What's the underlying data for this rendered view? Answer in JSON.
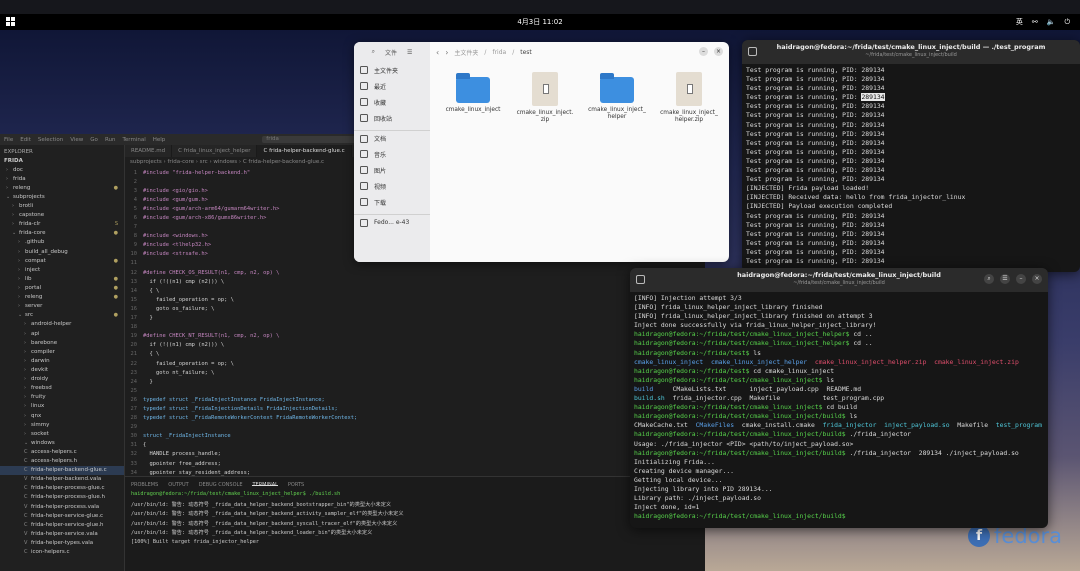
{
  "topbar": {
    "clock": "4月3日 11:02",
    "ime": "英"
  },
  "brand": {
    "name": "fedora"
  },
  "vscode": {
    "menu": [
      "File",
      "Edit",
      "Selection",
      "View",
      "Go",
      "Run",
      "Terminal",
      "Help"
    ],
    "search": "frida",
    "explorer": {
      "header": "EXPLORER",
      "root": "FRIDA",
      "items": [
        {
          "label": "doc",
          "arrow": "›",
          "indent": 1
        },
        {
          "label": "frida",
          "arrow": "›",
          "indent": 1
        },
        {
          "label": "releng",
          "arrow": "›",
          "indent": 1,
          "status": "●"
        },
        {
          "label": "subprojects",
          "arrow": "⌄",
          "indent": 1
        },
        {
          "label": "brotli",
          "arrow": "›",
          "indent": 2
        },
        {
          "label": "capstone",
          "arrow": "›",
          "indent": 2
        },
        {
          "label": "frida-clr",
          "arrow": "›",
          "indent": 2,
          "status": "S"
        },
        {
          "label": "frida-core",
          "arrow": "⌄",
          "indent": 2,
          "status": "●"
        },
        {
          "label": ".github",
          "arrow": "›",
          "indent": 3
        },
        {
          "label": "build_all_debug",
          "arrow": "›",
          "indent": 3
        },
        {
          "label": "compat",
          "arrow": "›",
          "indent": 3,
          "status": "●"
        },
        {
          "label": "inject",
          "arrow": "›",
          "indent": 3
        },
        {
          "label": "lib",
          "arrow": "›",
          "indent": 3,
          "status": "●"
        },
        {
          "label": "portal",
          "arrow": "›",
          "indent": 3,
          "status": "●"
        },
        {
          "label": "releng",
          "arrow": "›",
          "indent": 3,
          "status": "●"
        },
        {
          "label": "server",
          "arrow": "›",
          "indent": 3
        },
        {
          "label": "src",
          "arrow": "⌄",
          "indent": 3,
          "status": "●"
        },
        {
          "label": "android-helper",
          "arrow": "›",
          "indent": 4
        },
        {
          "label": "api",
          "arrow": "›",
          "indent": 4
        },
        {
          "label": "barebone",
          "arrow": "›",
          "indent": 4
        },
        {
          "label": "compiler",
          "arrow": "›",
          "indent": 4
        },
        {
          "label": "darwin",
          "arrow": "›",
          "indent": 4
        },
        {
          "label": "devkit",
          "arrow": "›",
          "indent": 4
        },
        {
          "label": "droidy",
          "arrow": "›",
          "indent": 4
        },
        {
          "label": "freebsd",
          "arrow": "›",
          "indent": 4
        },
        {
          "label": "fruity",
          "arrow": "›",
          "indent": 4
        },
        {
          "label": "linux",
          "arrow": "›",
          "indent": 4
        },
        {
          "label": "qnx",
          "arrow": "›",
          "indent": 4
        },
        {
          "label": "simmy",
          "arrow": "›",
          "indent": 4
        },
        {
          "label": "socket",
          "arrow": "›",
          "indent": 4
        },
        {
          "label": "windows",
          "arrow": "⌄",
          "indent": 4
        },
        {
          "label": "access-helpers.c",
          "arrow": "C",
          "indent": 4
        },
        {
          "label": "access-helpers.h",
          "arrow": "C",
          "indent": 4
        },
        {
          "label": "frida-helper-backend-glue.c",
          "arrow": "C",
          "indent": 4,
          "active": true
        },
        {
          "label": "frida-helper-backend.vala",
          "arrow": "V",
          "indent": 4
        },
        {
          "label": "frida-helper-process-glue.c",
          "arrow": "C",
          "indent": 4
        },
        {
          "label": "frida-helper-process-glue.h",
          "arrow": "C",
          "indent": 4
        },
        {
          "label": "frida-helper-process.vala",
          "arrow": "V",
          "indent": 4
        },
        {
          "label": "frida-helper-service-glue.c",
          "arrow": "C",
          "indent": 4
        },
        {
          "label": "frida-helper-service-glue.h",
          "arrow": "C",
          "indent": 4
        },
        {
          "label": "frida-helper-service.vala",
          "arrow": "V",
          "indent": 4
        },
        {
          "label": "frida-helper-types.vala",
          "arrow": "V",
          "indent": 4
        },
        {
          "label": "icon-helpers.c",
          "arrow": "C",
          "indent": 4
        }
      ]
    },
    "tabs": [
      "README.md",
      "C frida_linux_inject_helper",
      "C frida-helper-backend-glue.c"
    ],
    "breadcrumb": "subprojects › frida-core › src › windows › C frida-helper-backend-glue.c",
    "code": [
      "#include \"frida-helper-backend.h\"",
      "",
      "#include <gio/gio.h>",
      "#include <gum/gum.h>",
      "#include <gum/arch-arm64/gumarm64writer.h>",
      "#include <gum/arch-x86/gumx86writer.h>",
      "",
      "#include <windows.h>",
      "#include <tlhelp32.h>",
      "#include <strsafe.h>",
      "",
      "#define CHECK_OS_RESULT(n1, cmp, n2, op) \\",
      "  if (!((n1) cmp (n2))) \\",
      "  { \\",
      "    failed_operation = op; \\",
      "    goto os_failure; \\",
      "  }",
      "",
      "#define CHECK_NT_RESULT(n1, cmp, n2, op) \\",
      "  if (!((n1) cmp (n2))) \\",
      "  { \\",
      "    failed_operation = op; \\",
      "    goto nt_failure; \\",
      "  }",
      "",
      "typedef struct _FridaInjectInstance FridaInjectInstance;",
      "typedef struct _FridaInjectionDetails FridaInjectionDetails;",
      "typedef struct _FridaRemoteWorkerContext FridaRemoteWorkerContext;",
      "",
      "struct _FridaInjectInstance",
      "{",
      "  HANDLE process_handle;",
      "  gpointer free_address;",
      "  gpointer stay_resident_address;",
      "};",
      "",
      "struct _FridaInjectionDetails",
      "{"
    ],
    "panel_tabs": [
      "PROBLEMS",
      "OUTPUT",
      "DEBUG CONSOLE",
      "TERMINAL",
      "PORTS"
    ],
    "terminal": [
      "haidragon@fedora:~/frida/test/cmake_linux_inject_helper$ ./build.sh",
      "/usr/bin/ld: 警告: 动态符号 _frida_data_helper_backend_bootstrapper_bin\"的类型大小未定义",
      "/usr/bin/ld: 警告: 动态符号 _frida_data_helper_backend_activity_sampler_elf\"的类型大小未定义",
      "/usr/bin/ld: 警告: 动态符号 _frida_data_helper_backend_syscall_tracer_elf\"的类型大小未定义",
      "/usr/bin/ld: 警告: 动态符号 _frida_data_helper_backend_loader_bin\"的类型大小未定义",
      "[100%] Built target frida_injector_helper"
    ]
  },
  "files": {
    "title": "文件",
    "sidebar": [
      {
        "label": "主文件夹",
        "icon": "home-icon"
      },
      {
        "label": "最近",
        "icon": "clock-icon"
      },
      {
        "label": "收藏",
        "icon": "star-icon"
      },
      {
        "label": "回收站",
        "icon": "trash-icon"
      },
      {
        "label": "文档",
        "icon": "document-icon",
        "sep": true
      },
      {
        "label": "音乐",
        "icon": "music-icon"
      },
      {
        "label": "图片",
        "icon": "image-icon"
      },
      {
        "label": "视频",
        "icon": "video-icon"
      },
      {
        "label": "下载",
        "icon": "download-icon"
      },
      {
        "label": "Fedo... e-43",
        "icon": "drive-icon",
        "sep": true
      }
    ],
    "path": [
      "主文件夹",
      "frida",
      "test"
    ],
    "items": [
      {
        "name": "cmake_linux_inject",
        "kind": "folder"
      },
      {
        "name": "cmake_linux_inject.zip",
        "kind": "zip"
      },
      {
        "name": "cmake_linux_inject_helper",
        "kind": "folder"
      },
      {
        "name": "cmake_linux_inject_helper.zip",
        "kind": "zip"
      }
    ]
  },
  "term1": {
    "title": "haidragon@fedora:~/frida/test/cmake_linux_inject/build — ./test_program",
    "subtitle": "~/frida/test/cmake_linux_inject/build",
    "lines": [
      "Test program is running, PID: 289134",
      "Test program is running, PID: 289134",
      "Test program is running, PID: 289134",
      "Test program is running, PID: 289134",
      "Test program is running, PID: 289134",
      "Test program is running, PID: 289134",
      "Test program is running, PID: 289134",
      "Test program is running, PID: 289134",
      "Test program is running, PID: 289134",
      "Test program is running, PID: 289134",
      "Test program is running, PID: 289134",
      "Test program is running, PID: 289134",
      "Test program is running, PID: 289134",
      "[INJECTED] Frida payload loaded!",
      "[INJECTED] Received data: hello from frida_injector_linux",
      "[INJECTED] Payload execution completed",
      "Test program is running, PID: 289134",
      "Test program is running, PID: 289134",
      "Test program is running, PID: 289134",
      "Test program is running, PID: 289134",
      "Test program is running, PID: 289134",
      "Test program is running, PID: 289134"
    ],
    "highlighted": "289134"
  },
  "term2": {
    "title": "haidragon@fedora:~/frida/test/cmake_linux_inject/build",
    "subtitle": "~/frida/test/cmake_linux_inject/build",
    "lines": [
      "[INFO] Injection attempt 3/3",
      "[INFO] frida_linux_helper_inject_library finished",
      "[INFO] frida_linux_helper_inject_library finished on attempt 3",
      "Inject done successfully via frida_linux_helper_inject_library!",
      "haidragon@fedora:~/frida/test/cmake_linux_inject_helper$ cd ..",
      "haidragon@fedora:~/frida/test/cmake_linux_inject_helper$ cd ..",
      "haidragon@fedora:~/frida/test$ ls",
      "cmake_linux_inject  cmake_linux_inject_helper  cmake_linux_inject_helper.zip  cmake_linux_inject.zip",
      "haidragon@fedora:~/frida/test$ cd cmake_linux_inject",
      "haidragon@fedora:~/frida/test/cmake_linux_inject$ ls",
      "build     CMakeLists.txt      inject_payload.cpp  README.md",
      "build.sh  frida_injector.cpp  Makefile           test_program.cpp",
      "haidragon@fedora:~/frida/test/cmake_linux_inject$ cd build",
      "haidragon@fedora:~/frida/test/cmake_linux_inject/build$ ls",
      "CMakeCache.txt  CMakeFiles  cmake_install.cmake  frida_injector  inject_payload.so  Makefile  test_program",
      "haidragon@fedora:~/frida/test/cmake_linux_inject/build$ ./frida_injector",
      "Usage: ./frida_injector <PID> <path/to/inject_payload.so>",
      "haidragon@fedora:~/frida/test/cmake_linux_inject/build$ ./frida_injector  289134 ./inject_payload.so",
      "Initializing Frida...",
      "Creating device manager...",
      "Getting local device...",
      "Injecting library into PID 289134...",
      "Library path: ./inject_payload.so",
      "Inject done, id=1",
      "haidragon@fedora:~/frida/test/cmake_linux_inject/build$ "
    ]
  }
}
